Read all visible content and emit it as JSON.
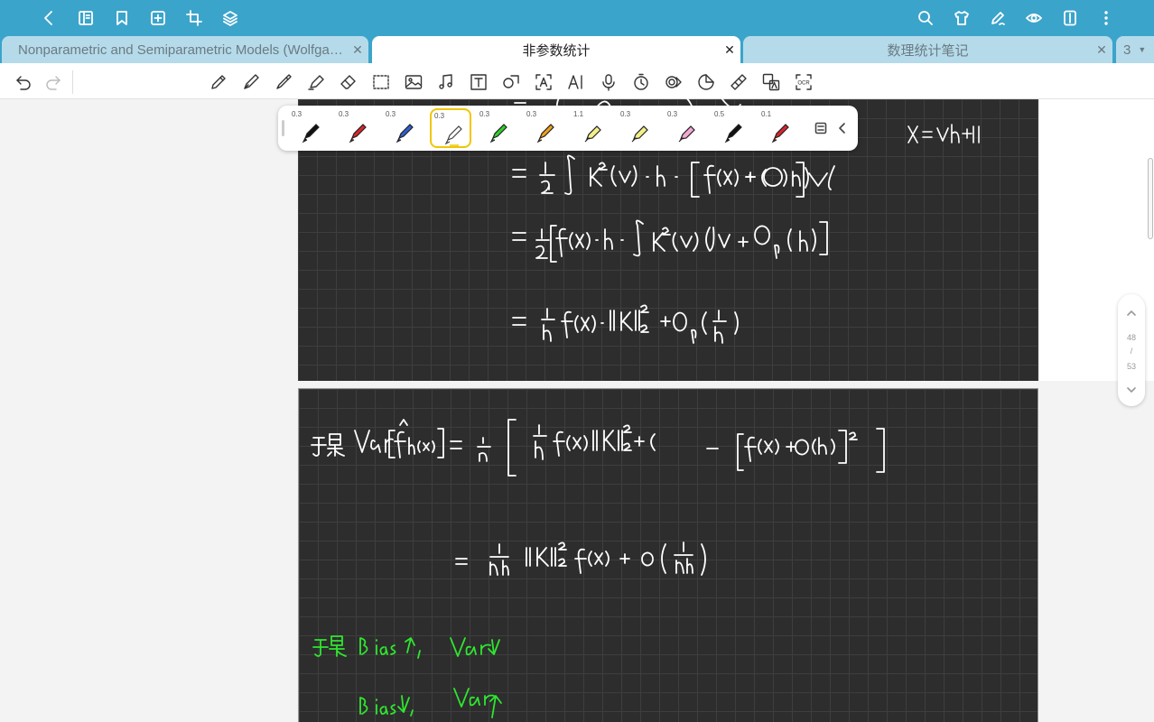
{
  "tabs": [
    {
      "label": "Nonparametric and Semiparametric Models (Wolfgang Härdle, Marlene Müller etc.)",
      "close": "✕"
    },
    {
      "label": "非参数统计",
      "close": "✕"
    },
    {
      "label": "数理统计笔记",
      "close": "✕"
    }
  ],
  "tab_overflow": {
    "count": "3"
  },
  "pen_palette": [
    {
      "size": "0.3",
      "color": "#111111",
      "kind": "pen"
    },
    {
      "size": "0.3",
      "color": "#d9262e",
      "kind": "pen"
    },
    {
      "size": "0.3",
      "color": "#2f5fd0",
      "kind": "pen"
    },
    {
      "size": "0.3",
      "color": "#ffffff",
      "kind": "pen",
      "selected": true
    },
    {
      "size": "0.3",
      "color": "#2ed12e",
      "kind": "pen"
    },
    {
      "size": "0.3",
      "color": "#f0a020",
      "kind": "pen"
    },
    {
      "size": "1.1",
      "color": "#f3f08a",
      "kind": "highlighter"
    },
    {
      "size": "0.3",
      "color": "#f3f08a",
      "kind": "highlighter"
    },
    {
      "size": "0.3",
      "color": "#f3a9d2",
      "kind": "highlighter"
    },
    {
      "size": "0.5",
      "color": "#111111",
      "kind": "pen"
    },
    {
      "size": "0.1",
      "color": "#d9262e",
      "kind": "pen"
    }
  ],
  "page_nav": {
    "current": "48",
    "sep": "/",
    "total": "53"
  },
  "colors": {
    "topbar": "#3ba4cb",
    "ink_white": "#ffffff",
    "ink_green": "#2ee62e",
    "canvas": "#2d2d2d"
  }
}
